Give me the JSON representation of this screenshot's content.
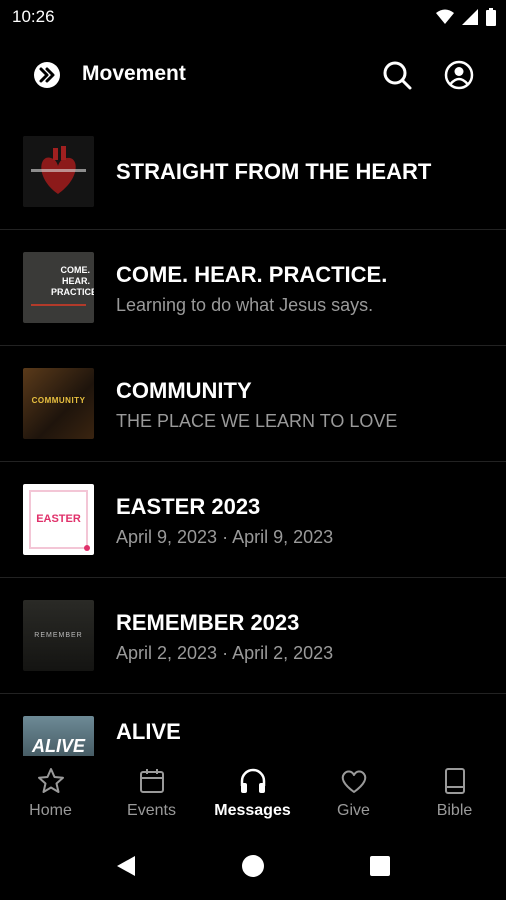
{
  "status_bar": {
    "time": "10:26"
  },
  "app_bar": {
    "title": "Movement"
  },
  "series": [
    {
      "title": "STRAIGHT FROM THE HEART",
      "subtitle": "",
      "thumb_text": ""
    },
    {
      "title": "COME. HEAR. PRACTICE.",
      "subtitle": "Learning to do what Jesus says.",
      "thumb_text": "COME. HEAR. PRACTICE."
    },
    {
      "title": "COMMUNITY",
      "subtitle": "THE PLACE WE LEARN TO LOVE",
      "thumb_text": "COMMUNITY"
    },
    {
      "title": "EASTER 2023",
      "subtitle": "April 9, 2023 · April 9, 2023",
      "thumb_text": "EASTER"
    },
    {
      "title": "REMEMBER 2023",
      "subtitle": "April 2, 2023 · April 2, 2023",
      "thumb_text": "REMEMBER"
    },
    {
      "title": "ALIVE",
      "subtitle": "",
      "thumb_text": "ALIVE"
    }
  ],
  "bottom_nav": [
    {
      "label": "Home",
      "icon": "star-icon",
      "active": false
    },
    {
      "label": "Events",
      "icon": "calendar-icon",
      "active": false
    },
    {
      "label": "Messages",
      "icon": "headphones-icon",
      "active": true
    },
    {
      "label": "Give",
      "icon": "heart-icon",
      "active": false
    },
    {
      "label": "Bible",
      "icon": "book-icon",
      "active": false
    }
  ],
  "colors": {
    "background": "#000000",
    "text": "#ffffff",
    "muted": "#9a9a9a",
    "divider": "#222222"
  }
}
